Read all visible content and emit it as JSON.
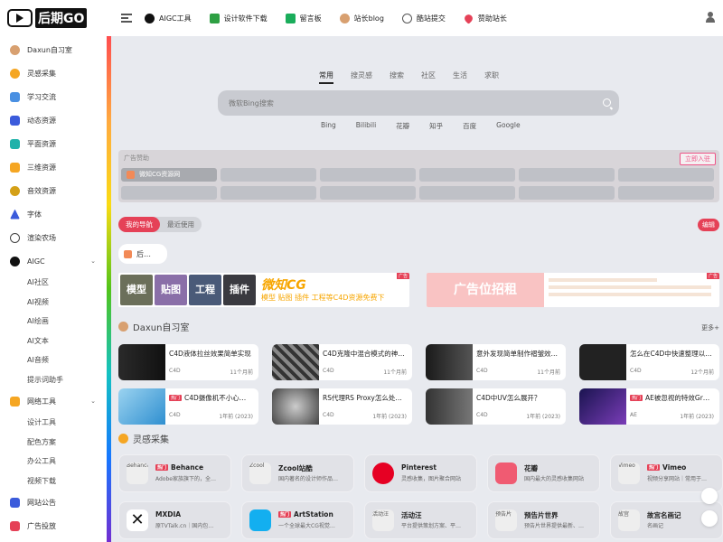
{
  "brand": {
    "logo_text": "后期GO"
  },
  "topnav": [
    {
      "label": "AIGC工具",
      "icon": "aigc-icon",
      "color": "#111111"
    },
    {
      "label": "设计软件下载",
      "icon": "download-icon",
      "color": "#2ea043"
    },
    {
      "label": "留言板",
      "icon": "message-icon",
      "color": "#1aad5b"
    },
    {
      "label": "站长blog",
      "icon": "avatar-icon",
      "color": "#d8a070"
    },
    {
      "label": "酷站提交",
      "icon": "cloud-icon",
      "color": "#555555"
    },
    {
      "label": "赞助站长",
      "icon": "heart-icon",
      "color": "#e54157"
    }
  ],
  "sidebar": {
    "items": [
      {
        "label": "Daxun自习室",
        "icon": "avatar-icon",
        "color": "#d8a070"
      },
      {
        "label": "灵感采集",
        "icon": "bulb-icon",
        "color": "#f5a623"
      },
      {
        "label": "学习交流",
        "icon": "book-icon",
        "color": "#4a90e2"
      },
      {
        "label": "动态资源",
        "icon": "film-icon",
        "color": "#3b5bdb"
      },
      {
        "label": "平面资源",
        "icon": "mountain-icon",
        "color": "#20b2aa"
      },
      {
        "label": "三维资源",
        "icon": "cube-icon",
        "color": "#f5a623"
      },
      {
        "label": "音效资源",
        "icon": "music-icon",
        "color": "#d4a017"
      },
      {
        "label": "字体",
        "icon": "font-icon",
        "color": "#3b5bdb"
      },
      {
        "label": "渲染农场",
        "icon": "clock-icon",
        "color": "#444444"
      },
      {
        "label": "AIGC",
        "icon": "aigc-icon",
        "color": "#111111"
      }
    ],
    "aigc_sub": [
      "AI社区",
      "AI视频",
      "AI绘画",
      "AI文本",
      "AI音频",
      "提示词助手"
    ],
    "tools": {
      "label": "网络工具",
      "icon": "monitor-icon",
      "color": "#f5a623"
    },
    "tools_sub": [
      "设计工具",
      "配色方案",
      "办公工具",
      "视频下载"
    ],
    "bottom": [
      {
        "label": "网站公告",
        "icon": "speaker-icon",
        "color": "#3b5bdb"
      },
      {
        "label": "广告投放",
        "icon": "ad-icon",
        "color": "#e54157"
      }
    ]
  },
  "search": {
    "tabs": [
      "常用",
      "搜灵感",
      "搜索",
      "社区",
      "生活",
      "求职"
    ],
    "active_tab": "常用",
    "placeholder": "微软Bing搜索",
    "engines": [
      "Bing",
      "Bilibili",
      "花瓣",
      "知乎",
      "百度",
      "Google"
    ]
  },
  "ad_panel": {
    "header": "广告赞助",
    "enter_label": "立即入驻",
    "first_cell": "微知CG资源网"
  },
  "nav_tabs": {
    "mine": "我的导航",
    "recent": "最近使用",
    "edit": "编辑"
  },
  "my_site": "后…",
  "banner1": {
    "thumbs": [
      "模型",
      "贴图",
      "工程",
      "插件"
    ],
    "title": "微知CG",
    "subtitle": "模型 贴图 插件 工程等C4D资源免费下",
    "tag": "广告"
  },
  "banner2": {
    "text": "广告位招租",
    "tag": "广告"
  },
  "sections": {
    "daxun": {
      "title": "Daxun自习室",
      "more": "更多+"
    },
    "inspiration": {
      "title": "灵感采集"
    }
  },
  "cards": [
    {
      "title": "C4D液体拉丝效果简单实现",
      "tag": "C4D",
      "time": "11个月前",
      "hot": false
    },
    {
      "title": "C4D克隆中混合模式的神…",
      "tag": "C4D",
      "time": "11个月前",
      "hot": false
    },
    {
      "title": "意外发现简单制作褶皱效…",
      "tag": "C4D",
      "time": "11个月前",
      "hot": false
    },
    {
      "title": "怎么在C4D中快速整理以…",
      "tag": "C4D",
      "time": "12个月前",
      "hot": false
    },
    {
      "title": "C4D摄像机不小心…",
      "tag": "C4D",
      "time": "1年前 (2023)",
      "hot": true
    },
    {
      "title": "RS代理RS Proxy怎么处…",
      "tag": "C4D",
      "time": "1年前 (2023)",
      "hot": false
    },
    {
      "title": "C4D中UV怎么展开？",
      "tag": "C4D",
      "time": "1年前 (2023)",
      "hot": false
    },
    {
      "title": "AE被忽视的特效Gr…",
      "tag": "AE",
      "time": "1年前 (2023)",
      "hot": true
    }
  ],
  "hot_label": "热门",
  "sites": [
    {
      "name": "Behance",
      "desc": "Adobe家族旗下的，全…",
      "icon_text": "Behance",
      "hot": true
    },
    {
      "name": "Zcool站酷",
      "desc": "国内著名的设计师作品…",
      "icon_text": "Zcool",
      "hot": false
    },
    {
      "name": "Pinterest",
      "desc": "灵感收集，图片聚合网站",
      "icon_text": "",
      "hot": false
    },
    {
      "name": "花瓣",
      "desc": "国内最大的灵感收集网站",
      "icon_text": "",
      "hot": false
    },
    {
      "name": "Vimeo",
      "desc": "视频分享网站｜常用于…",
      "icon_text": "Vimeo",
      "hot": true
    },
    {
      "name": "MXDIA",
      "desc": "原TVTalk.cn｜国内包…",
      "icon_text": "",
      "hot": false
    },
    {
      "name": "ArtStation",
      "desc": "一个全球最大CG视觉…",
      "icon_text": "",
      "hot": true
    },
    {
      "name": "活动汪",
      "desc": "平台提供策划方案、平…",
      "icon_text": "活动汪",
      "hot": false
    },
    {
      "name": "预告片世界",
      "desc": "预告片世界提供最新、…",
      "icon_text": "预告片",
      "hot": false
    },
    {
      "name": "故宫名画记",
      "desc": "名画记",
      "icon_text": "故宫",
      "hot": false
    }
  ]
}
